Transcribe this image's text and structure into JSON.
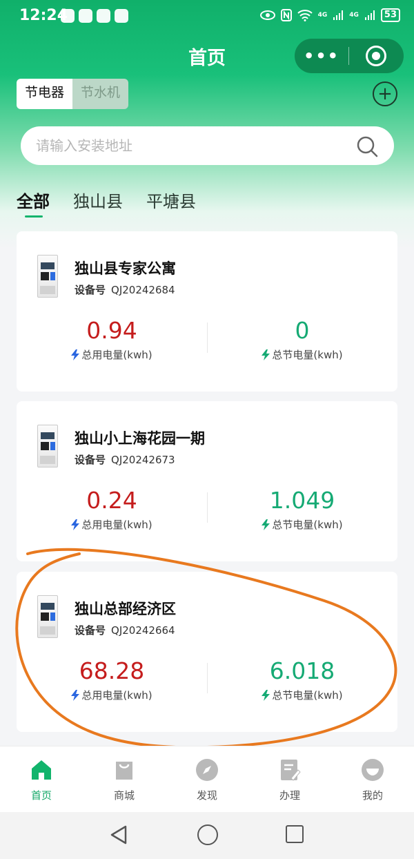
{
  "status_bar": {
    "time": "12:24",
    "network_1": "4G",
    "network_2": "4G",
    "battery": "53"
  },
  "header": {
    "title": "首页",
    "more_icon": "more-dots-icon",
    "close_icon": "target-icon"
  },
  "segment": {
    "options": [
      "节电器",
      "节水机"
    ],
    "selected": "节电器"
  },
  "search": {
    "placeholder": "请输入安装地址"
  },
  "tabs": {
    "items": [
      "全部",
      "独山县",
      "平塘县"
    ],
    "selected": "全部"
  },
  "cards": [
    {
      "name": "独山县专家公寓",
      "device_label": "设备号",
      "device_id": "QJ20242684",
      "total_usage": "0.94",
      "total_usage_label": "总用电量(kwh)",
      "total_saved": "0",
      "total_saved_label": "总节电量(kwh)"
    },
    {
      "name": "独山小上海花园一期",
      "device_label": "设备号",
      "device_id": "QJ20242673",
      "total_usage": "0.24",
      "total_usage_label": "总用电量(kwh)",
      "total_saved": "1.049",
      "total_saved_label": "总节电量(kwh)"
    },
    {
      "name": "独山总部经济区",
      "device_label": "设备号",
      "device_id": "QJ20242664",
      "total_usage": "68.28",
      "total_usage_label": "总用电量(kwh)",
      "total_saved": "6.018",
      "total_saved_label": "总节电量(kwh)"
    }
  ],
  "tabbar": {
    "items": [
      {
        "label": "首页",
        "icon": "home-icon"
      },
      {
        "label": "商城",
        "icon": "shopping-bag-icon"
      },
      {
        "label": "发现",
        "icon": "compass-icon"
      },
      {
        "label": "办理",
        "icon": "edit-document-icon"
      },
      {
        "label": "我的",
        "icon": "profile-icon"
      }
    ],
    "selected": "首页"
  },
  "colors": {
    "accent": "#12b46c",
    "usage": "#c51d1d",
    "saved": "#16aa74",
    "annotation": "#e8791f"
  }
}
